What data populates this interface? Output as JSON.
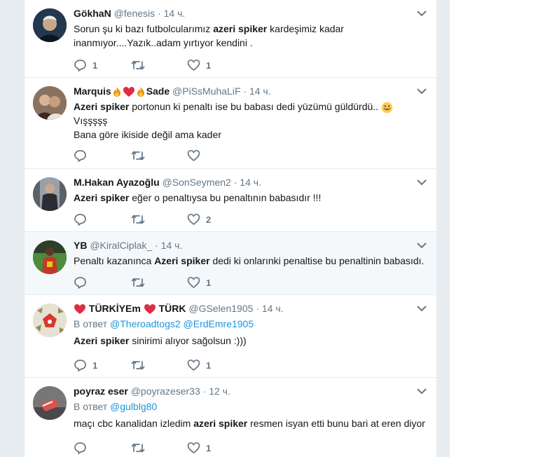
{
  "tweets": [
    {
      "name": "GökhaN",
      "handle": "@fenesis",
      "dot": "·",
      "time": "14 ч.",
      "text_lines": [
        [
          {
            "t": "Sorun şu ki bazı futbolcularımız "
          },
          {
            "t": "azeri spiker",
            "b": true
          },
          {
            "t": " kardeşimiz kadar"
          }
        ],
        [
          {
            "t": "inanmıyor....Yazık..adam yırtıyor kendini ."
          }
        ]
      ],
      "counts": {
        "reply": "1",
        "retweet": "",
        "like": "1"
      }
    },
    {
      "name_parts": [
        "Marquis",
        "Sade"
      ],
      "handle": "@PiSsMuhaLiF",
      "dot": "·",
      "time": "14 ч.",
      "text_lines": [
        [
          {
            "t": "Azeri spiker",
            "b": true
          },
          {
            "t": " portonun ki penaltı ise bu babası dedi yüzümü güldürdü.. "
          }
        ],
        [
          {
            "t": "Vışşşşş"
          }
        ],
        [
          {
            "t": "Bana göre ikiside değil ama kader"
          }
        ]
      ],
      "counts": {
        "reply": "",
        "retweet": "",
        "like": ""
      }
    },
    {
      "name": "M.Hakan Ayazoğlu",
      "handle": "@SonSeymen2",
      "dot": "·",
      "time": "14 ч.",
      "text_lines": [
        [
          {
            "t": "Azeri spiker",
            "b": true
          },
          {
            "t": " eğer o penaltıysa bu penaltının babasıdır !!!"
          }
        ]
      ],
      "counts": {
        "reply": "",
        "retweet": "",
        "like": "2"
      }
    },
    {
      "name": "YB",
      "handle": "@KiralCiplak_",
      "dot": "·",
      "time": "14 ч.",
      "text_lines": [
        [
          {
            "t": "Penaltı kazanınca "
          },
          {
            "t": "Azeri spiker",
            "b": true
          },
          {
            "t": " dedi ki onlarınki penaltise bu penaltinin babasıdı."
          }
        ]
      ],
      "counts": {
        "reply": "",
        "retweet": "",
        "like": "1"
      }
    },
    {
      "name_parts": [
        "TÜRKİYEm",
        "TÜRK"
      ],
      "handle": "@GSelen1905",
      "dot": "·",
      "time": "14 ч.",
      "reply_prefix": "В ответ",
      "reply_to": [
        "@Theroadtogs2",
        "@ErdEmre1905"
      ],
      "text_lines": [
        [
          {
            "t": "Azeri spiker",
            "b": true
          },
          {
            "t": " sinirimi alıyor sağolsun :)))"
          }
        ]
      ],
      "counts": {
        "reply": "1",
        "retweet": "",
        "like": "1"
      }
    },
    {
      "name": "poyraz eser",
      "handle": "@poyrazeser33",
      "dot": "·",
      "time": "12 ч.",
      "reply_prefix": "В ответ",
      "reply_to": [
        "@gulblg80"
      ],
      "text_lines": [
        [
          {
            "t": "maçı cbc kanalidan izledim "
          },
          {
            "t": "azeri spiker",
            "b": true
          },
          {
            "t": " resmen isyan etti bunu bari at eren diyor"
          }
        ]
      ],
      "counts": {
        "reply": "",
        "retweet": "",
        "like": "1"
      }
    }
  ],
  "colors": {
    "accent": "#1b95e0",
    "muted": "#657786",
    "heart_emoji": "#e0245e",
    "fire_emoji": "#f4900c"
  },
  "icons": [
    "reply-icon",
    "retweet-icon",
    "like-icon",
    "caret-down-icon",
    "fire-emoji-icon",
    "heart-emoji-icon",
    "grinning-emoji-icon"
  ]
}
